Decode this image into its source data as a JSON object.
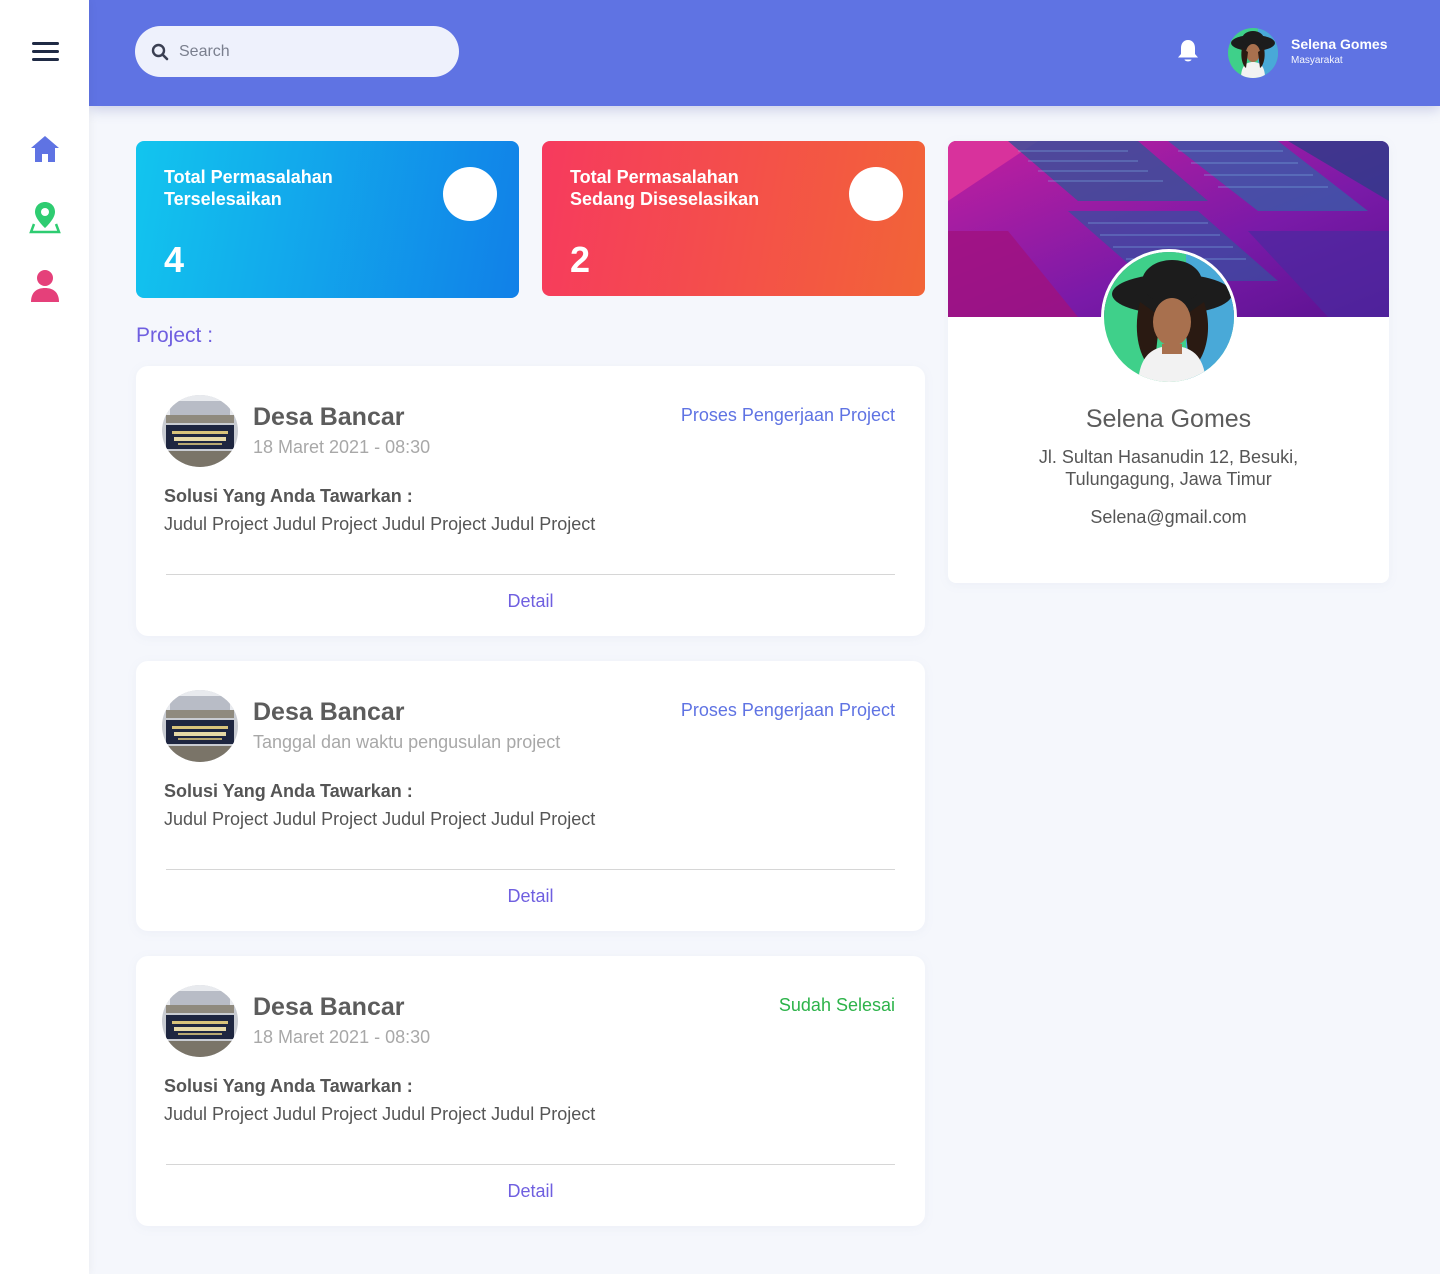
{
  "header": {
    "search_placeholder": "Search",
    "user_name": "Selena Gomes",
    "user_role": "Masyarakat"
  },
  "sidebar": {
    "items": [
      {
        "icon": "home-icon",
        "color": "#5f73e3"
      },
      {
        "icon": "map-pin-icon",
        "color": "#2ecc71"
      },
      {
        "icon": "user-icon",
        "color": "#e5407a"
      }
    ]
  },
  "stats": [
    {
      "label_line1": "Total Permasalahan",
      "label_line2": "Terselesaikan",
      "value": "4",
      "color": "#1190e9"
    },
    {
      "label_line1": "Total Permasalahan",
      "label_line2": "Sedang Diseselasikan",
      "value": "2",
      "color": "#f44a4d"
    }
  ],
  "section_title": "Project :",
  "projects": [
    {
      "name": "Desa Bancar",
      "date": "18 Maret 2021 - 08:30",
      "status": "Proses Pengerjaan Project",
      "solution_label": "Solusi Yang Anda Tawarkan :",
      "solution_text": "Judul Project Judul Project Judul Project Judul Project",
      "detail_label": "Detail"
    },
    {
      "name": "Desa Bancar",
      "date": "Tanggal dan waktu pengusulan project",
      "status": "Proses Pengerjaan Project",
      "solution_label": "Solusi Yang Anda Tawarkan :",
      "solution_text": "Judul Project Judul Project Judul Project Judul Project",
      "detail_label": "Detail"
    },
    {
      "name": "Desa Bancar",
      "date": "18 Maret 2021 - 08:30",
      "status": "Sudah Selesai",
      "solution_label": "Solusi Yang Anda Tawarkan :",
      "solution_text": "Judul Project Judul Project Judul Project Judul Project",
      "detail_label": "Detail"
    }
  ],
  "profile": {
    "name": "Selena Gomes",
    "address": "Jl. Sultan Hasanudin 12, Besuki, Tulungagung, Jawa Timur",
    "email": "Selena@gmail.com"
  },
  "colors": {
    "header": "#5f73e3",
    "accent": "#6f5fe0",
    "status_progress": "#5f73e3",
    "status_done": "#2db34a"
  }
}
